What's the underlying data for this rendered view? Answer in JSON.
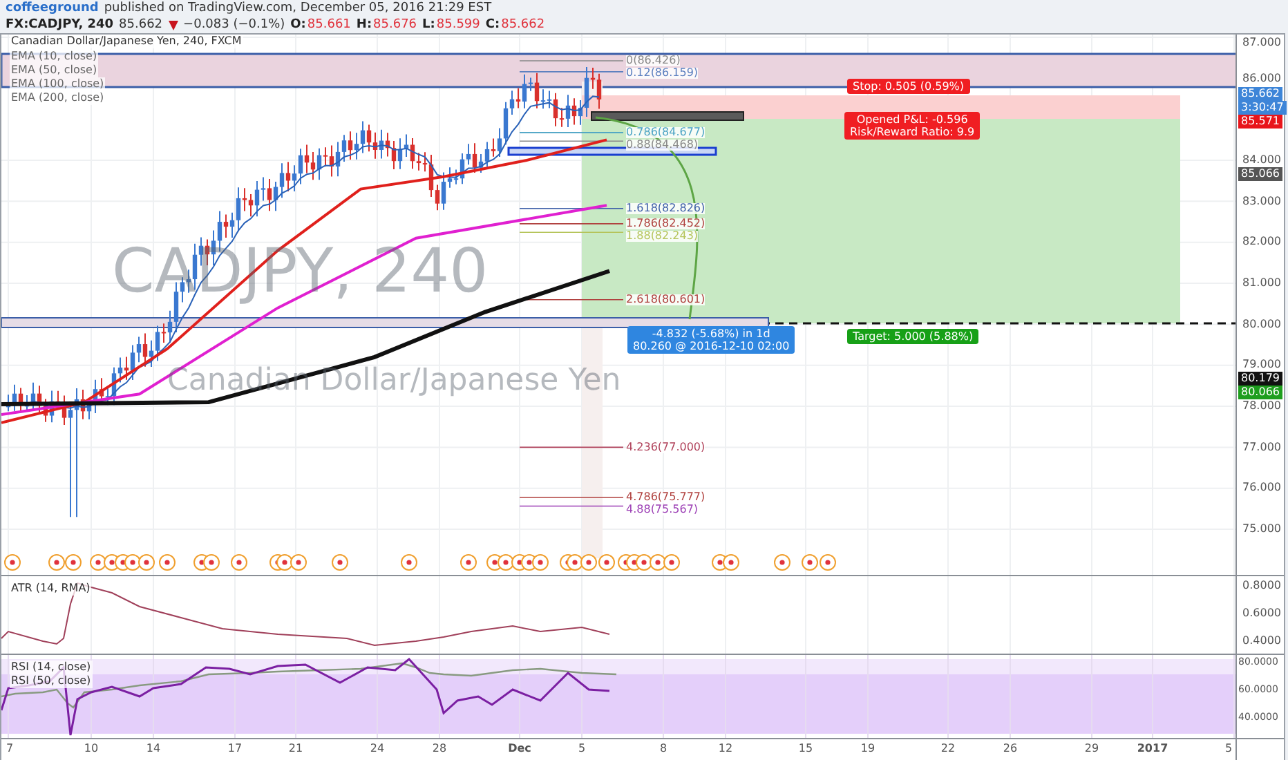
{
  "publish": {
    "author": "coffeeground",
    "text": "published on TradingView.com, December 05, 2016 21:29 EST"
  },
  "quote": {
    "symbol": "FX:CADJPY, 240",
    "last": "85.662",
    "change": "−0.083 (−0.1%)",
    "ohlc": [
      {
        "label": "O:",
        "value": "85.661"
      },
      {
        "label": "H:",
        "value": "85.676"
      },
      {
        "label": "L:",
        "value": "85.599"
      },
      {
        "label": "C:",
        "value": "85.662"
      }
    ]
  },
  "chart": {
    "legend": {
      "title": "Canadian Dollar/Japanese Yen, 240, FXCM",
      "studies": [
        "EMA (10, close)",
        "EMA (50, close)",
        "EMA (100, close)",
        "EMA (200, close)"
      ]
    },
    "watermark": {
      "symbol": "CADJPY, 240",
      "description": "Canadian Dollar/Japanese Yen"
    },
    "fib_levels": [
      {
        "label": "0(86.426)",
        "color": "#888888"
      },
      {
        "label": "0.12(86.159)",
        "color": "#5b7fbf"
      },
      {
        "label": "0.786(84.677)",
        "color": "#4aa3c4"
      },
      {
        "label": "0.88(84.468)",
        "color": "#888888"
      },
      {
        "label": "1.618(82.826)",
        "color": "#3d5fa8"
      },
      {
        "label": "1.786(82.452)",
        "color": "#b0413e"
      },
      {
        "label": "1.88(82.243)",
        "color": "#b5c45a"
      },
      {
        "label": "2.618(80.601)",
        "color": "#b0413e"
      },
      {
        "label": "4.236(77.000)",
        "color": "#b0415a"
      },
      {
        "label": "4.786(75.777)",
        "color": "#b0413e"
      },
      {
        "label": "4.88(75.567)",
        "color": "#9c3fb5"
      }
    ],
    "projection": {
      "change": "-4.832 (-5.68%) in 1d",
      "target": "80.260 @ 2016-12-10 02:00"
    },
    "position": {
      "stop": "Stop: 0.505 (0.59%)",
      "pnl": "Opened P&L: -0.596",
      "ratio": "Risk/Reward Ratio: 9.9",
      "target": "Target: 5.000 (5.88%)"
    },
    "price_axis": [
      "87.000",
      "86.000",
      "84.000",
      "83.000",
      "82.000",
      "81.000",
      "80.000",
      "79.000",
      "78.000",
      "77.000",
      "76.000",
      "75.000"
    ],
    "price_badges": [
      {
        "text": "85.662",
        "color": "#3d85d8"
      },
      {
        "text": "3:30:47",
        "color": "#3d85d8"
      },
      {
        "text": "85.571",
        "color": "#e8151b"
      },
      {
        "text": "85.066",
        "color": "#555555"
      },
      {
        "text": "80.179",
        "color": "#111111"
      },
      {
        "text": "80.066",
        "color": "#1e9e1e"
      }
    ]
  },
  "atr": {
    "legend": "ATR (14, RMA)",
    "axis": [
      "0.8000",
      "0.6000",
      "0.4000"
    ]
  },
  "rsi": {
    "legends": [
      "RSI (14, close)",
      "RSI (50, close)"
    ],
    "axis": [
      "80.0000",
      "60.0000",
      "40.0000"
    ]
  },
  "time_axis": [
    {
      "label": "7",
      "kind": "day"
    },
    {
      "label": "10",
      "kind": "day"
    },
    {
      "label": "14",
      "kind": "day"
    },
    {
      "label": "17",
      "kind": "day"
    },
    {
      "label": "21",
      "kind": "day"
    },
    {
      "label": "24",
      "kind": "day"
    },
    {
      "label": "28",
      "kind": "day"
    },
    {
      "label": "Dec",
      "kind": "month"
    },
    {
      "label": "5",
      "kind": "day"
    },
    {
      "label": "8",
      "kind": "day"
    },
    {
      "label": "12",
      "kind": "day"
    },
    {
      "label": "15",
      "kind": "day"
    },
    {
      "label": "19",
      "kind": "day"
    },
    {
      "label": "22",
      "kind": "day"
    },
    {
      "label": "26",
      "kind": "day"
    },
    {
      "label": "29",
      "kind": "day"
    },
    {
      "label": "2017",
      "kind": "year"
    },
    {
      "label": "5",
      "kind": "day"
    }
  ]
}
